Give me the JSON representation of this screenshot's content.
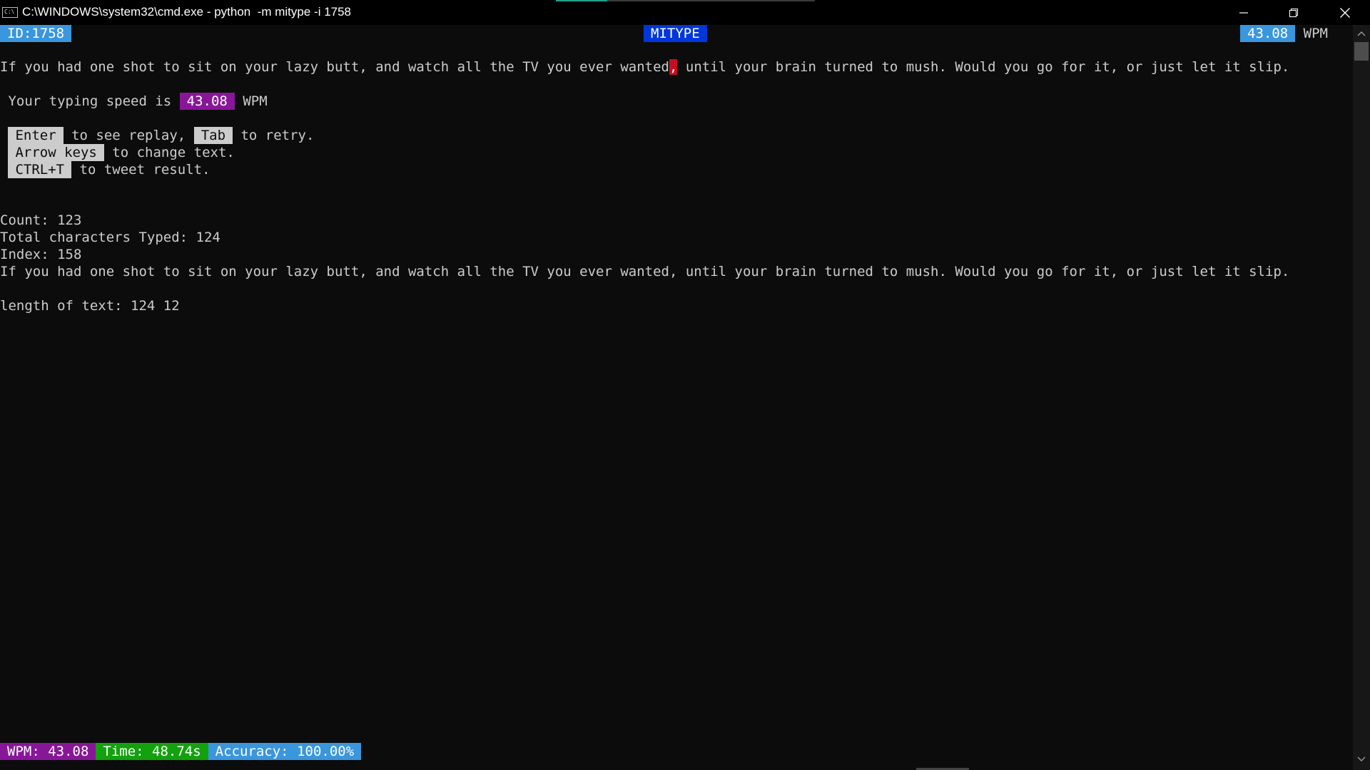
{
  "window": {
    "title": "C:\\WINDOWS\\system32\\cmd.exe - python  -m mitype -i 1758",
    "icon_label": "C:\\",
    "icon": "cmd-app-icon",
    "controls": [
      "minimize-icon",
      "restore-icon",
      "close-icon"
    ]
  },
  "header": {
    "id_label": "ID:1758",
    "app_name": "MITYPE",
    "wpm_value": "43.08",
    "wpm_unit": "WPM"
  },
  "typing_line": {
    "before_cursor": "If you had one shot to sit on your lazy butt, and watch all the TV you ever wanted",
    "cursor_char": ",",
    "after_cursor": " until your brain turned to mush. Would you go for it, or just let it slip."
  },
  "result": {
    "prefix": " Your typing speed is ",
    "wpm": "43.08",
    "suffix": "WPM"
  },
  "hints": [
    {
      "keys": [
        {
          "key": "Enter",
          "after": " to see replay, "
        },
        {
          "key": "Tab",
          "after": " to retry."
        }
      ]
    },
    {
      "keys": [
        {
          "key": "Arrow keys",
          "after": " to change text."
        }
      ]
    },
    {
      "keys": [
        {
          "key": "CTRL+T",
          "after": " to tweet result."
        }
      ]
    }
  ],
  "debug": {
    "count": "Count: 123",
    "total_typed": "Total characters Typed: 124",
    "index": "Index: 158",
    "text": "If you had one shot to sit on your lazy butt, and watch all the TV you ever wanted, until your brain turned to mush. Would you go for it, or just let it slip.",
    "length": "length of text: 124 12"
  },
  "status": {
    "wpm": "WPM: 43.08",
    "time": "Time: 48.74s",
    "accuracy": "Accuracy: 100.00%"
  },
  "colors": {
    "terminal_bg": "#0c0c0c",
    "text": "#cccccc",
    "blue": "#3a96dd",
    "dark_blue": "#0037da",
    "purple": "#881798",
    "green": "#13a10e",
    "cursor_red": "#c50f1f"
  }
}
